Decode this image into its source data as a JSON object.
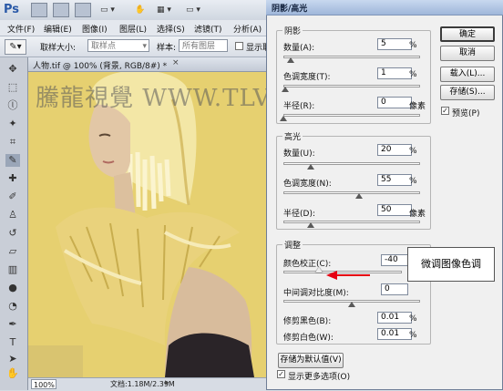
{
  "app": {
    "logo": "Ps",
    "menus": [
      "文件(F)",
      "编辑(E)",
      "图像(I)",
      "图层(L)",
      "选择(S)",
      "滤镜(T)",
      "分析(A)"
    ],
    "options": {
      "sample_size_label": "取样大小:",
      "sample_size_value": "取样点",
      "sample_label": "样本:",
      "sample_value": "所有图层",
      "show_ring_label": "显示取"
    },
    "document": {
      "tab_title": "人物.tif @ 100% (背景, RGB/8#) *",
      "zoom": "100%",
      "doc_info": "文档:1.18M/2.39M"
    },
    "watermark": "騰龍視覺 WWW.TLVI.NET"
  },
  "dialog": {
    "title": "阴影/高光",
    "shadows": {
      "group_label": "阴影",
      "amount_label": "数量(A):",
      "amount_value": "5",
      "amount_unit": "%",
      "amount_level": 0.05,
      "tone_label": "色调宽度(T):",
      "tone_value": "1",
      "tone_unit": "%",
      "tone_level": 0.01,
      "radius_label": "半径(R):",
      "radius_value": "0",
      "radius_unit": "像素",
      "radius_level": 0.0
    },
    "highlights": {
      "group_label": "高光",
      "amount_label": "数量(U):",
      "amount_value": "20",
      "amount_unit": "%",
      "amount_level": 0.2,
      "tone_label": "色调宽度(N):",
      "tone_value": "55",
      "tone_unit": "%",
      "tone_level": 0.55,
      "radius_label": "半径(D):",
      "radius_value": "50",
      "radius_unit": "像素",
      "radius_level": 0.2
    },
    "adjustments": {
      "group_label": "调整",
      "color_label": "颜色校正(C):",
      "color_value": "-40",
      "color_level": 0.3,
      "midtone_label": "中间调对比度(M):",
      "midtone_value": "0",
      "midtone_level": 0.5,
      "black_clip_label": "修剪黑色(B):",
      "black_clip_value": "0.01",
      "black_clip_unit": "%",
      "white_clip_label": "修剪白色(W):",
      "white_clip_value": "0.01",
      "white_clip_unit": "%"
    },
    "buttons": {
      "ok": "确定",
      "cancel": "取消",
      "load": "载入(L)...",
      "save": "存储(S)...",
      "save_defaults": "存储为默认值(V)"
    },
    "preview_label": "预览(P)",
    "preview_checked": true,
    "more_options_label": "显示更多选项(O)",
    "more_options_checked": true
  },
  "annotation": {
    "callout_text": "微调图像色调",
    "arrow_color": "#e60012"
  }
}
